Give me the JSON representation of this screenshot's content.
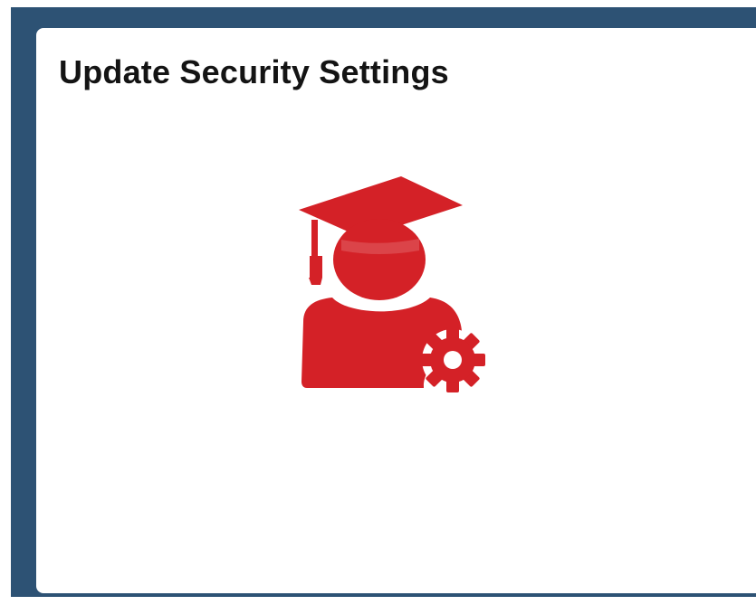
{
  "tile": {
    "title": "Update Security Settings",
    "icon": "graduate-user-gear-icon"
  },
  "colors": {
    "background_frame": "#2d5274",
    "tile_background": "#ffffff",
    "icon_red": "#d42127",
    "title_text": "#141414"
  }
}
